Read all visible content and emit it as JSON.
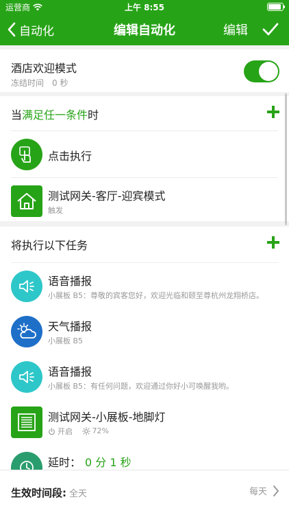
{
  "status_bar": {
    "carrier": "运营商",
    "time": "上午 8:55"
  },
  "nav": {
    "back_label": "自动化",
    "title": "编辑自动化",
    "edit_label": "编辑"
  },
  "mode": {
    "name": "酒店欢迎模式",
    "sub": "冻结时间　0 秒",
    "enabled": true
  },
  "conditions": {
    "head_prefix": "当",
    "head_highlight": "满足任一条件",
    "head_suffix": "时",
    "items": [
      {
        "title": "点击执行",
        "icon": "tap-hand-icon",
        "color": "#27a317"
      },
      {
        "title": "测试网关-客厅-迎宾模式",
        "sub": "触发",
        "icon": "home-icon",
        "color": "#27a317"
      }
    ]
  },
  "tasks": {
    "head": "将执行以下任务",
    "items": [
      {
        "title": "语音播报",
        "sub": "小展板 B5：尊敬的宾客您好，欢迎光临和颐至尊杭州龙翔桥店。",
        "icon": "speaker-icon",
        "color": "#2ec7c9"
      },
      {
        "title": "天气播报",
        "sub": "小展板 B5",
        "icon": "weather-cloud-icon",
        "color": "#1e6fc8"
      },
      {
        "title": "语音播报",
        "sub": "小展板 B5：有任何问题，欢迎通过你好小可唤醒我哟。",
        "icon": "speaker-icon",
        "color": "#2ec7c9"
      },
      {
        "title": "测试网关-小展板-地脚灯",
        "power": "开启",
        "brightness": "72%",
        "icon": "floor-light-icon",
        "color": "#27a317"
      },
      {
        "title": "延时：",
        "delay": "0 分 1 秒",
        "icon": "clock-icon",
        "color": "#2a9d6e"
      }
    ]
  },
  "footer": {
    "label": "生效时间段:",
    "value": "全天",
    "repeat": "每天"
  },
  "colors": {
    "brand": "#27a317",
    "teal": "#2ec7c9",
    "blue": "#1e6fc8"
  }
}
